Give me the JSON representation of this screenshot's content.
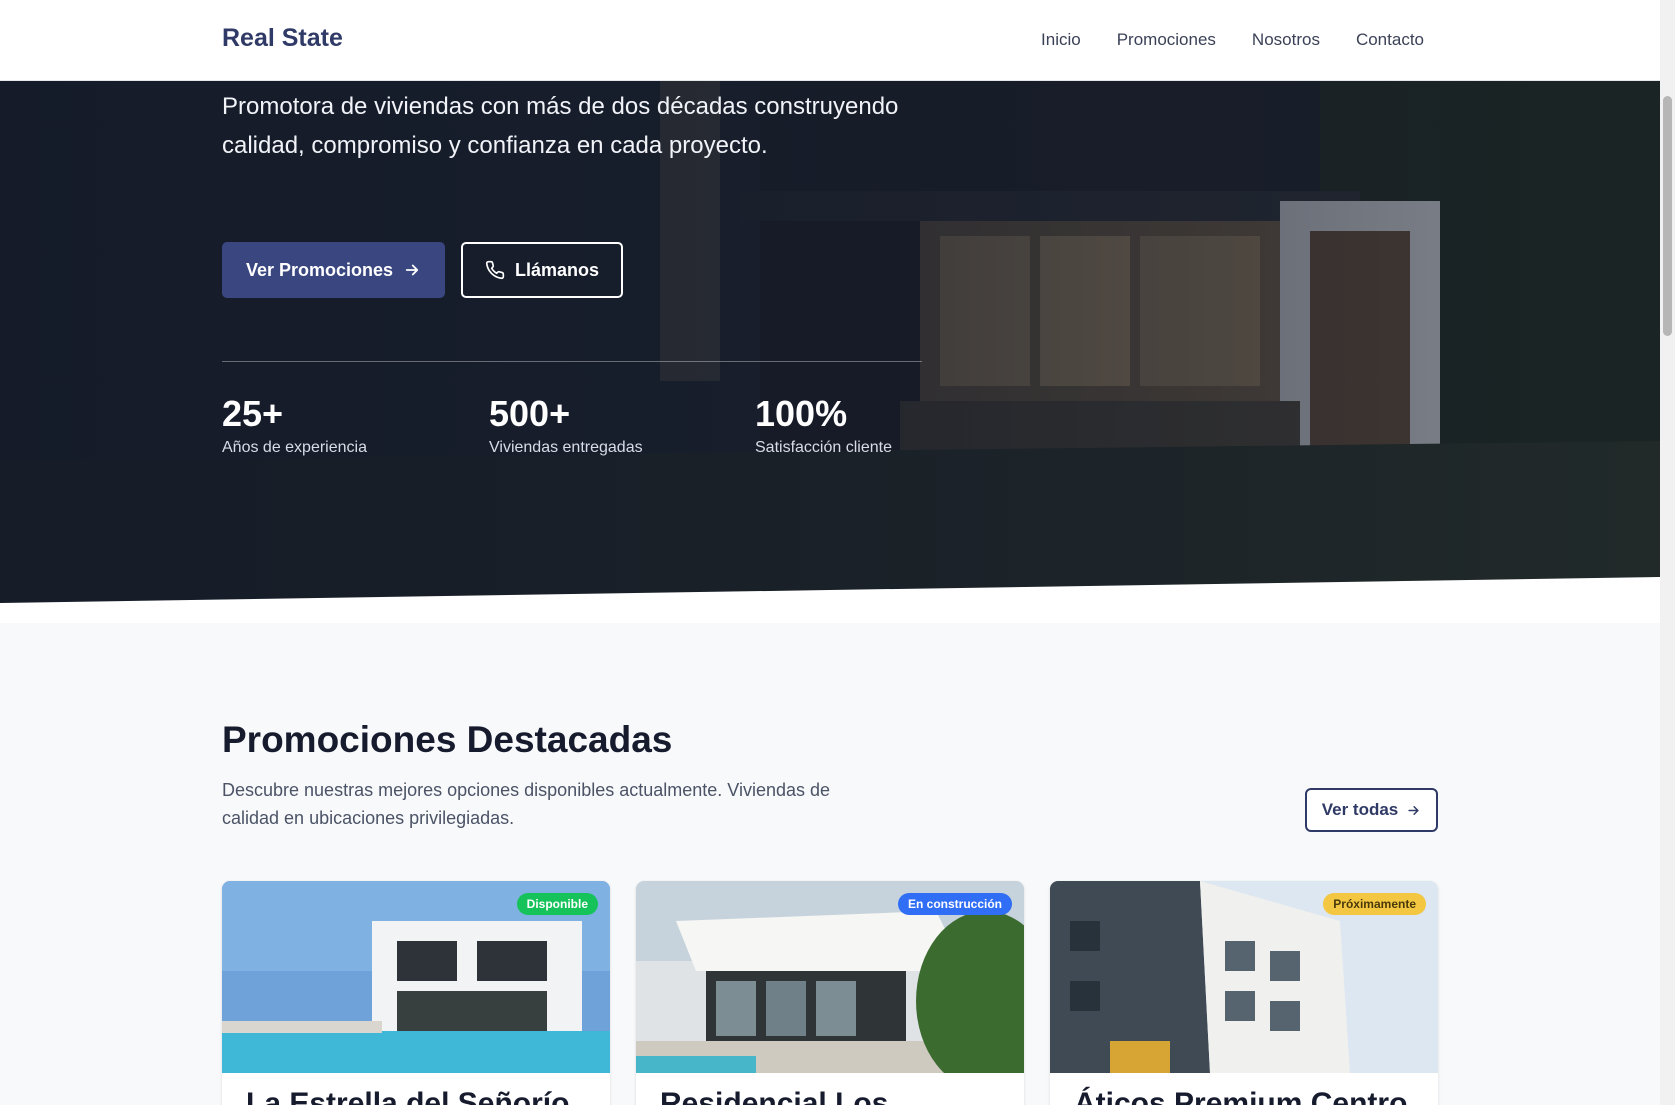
{
  "nav": {
    "brand": "Real State",
    "links": [
      "Inicio",
      "Promociones",
      "Nosotros",
      "Contacto"
    ]
  },
  "hero": {
    "text": "Promotora de viviendas con más de dos décadas construyendo calidad, compromiso y confianza en cada proyecto.",
    "primary_button": "Ver Promociones",
    "secondary_button": "Llámanos",
    "stats": [
      {
        "value": "25+",
        "label": "Años de experiencia"
      },
      {
        "value": "500+",
        "label": "Viviendas entregadas"
      },
      {
        "value": "100%",
        "label": "Satisfacción cliente"
      }
    ]
  },
  "featured": {
    "title": "Promociones Destacadas",
    "description": "Descubre nuestras mejores opciones disponibles actualmente. Viviendas de calidad en ubicaciones privilegiadas.",
    "view_all": "Ver todas",
    "cards": [
      {
        "title": "La Estrella del Señorío",
        "badge": "Disponible",
        "badge_bg": "#16c25a",
        "badge_fg": "#ffffff"
      },
      {
        "title": "Residencial Los",
        "badge": "En construcción",
        "badge_bg": "#2f6ef5",
        "badge_fg": "#ffffff"
      },
      {
        "title": "Áticos Premium Centro",
        "badge": "Próximamente",
        "badge_bg": "#f4c742",
        "badge_fg": "#4a3a0a"
      }
    ]
  },
  "colors": {
    "brand": "#2f3a66",
    "primary_button": "#3a4680"
  }
}
